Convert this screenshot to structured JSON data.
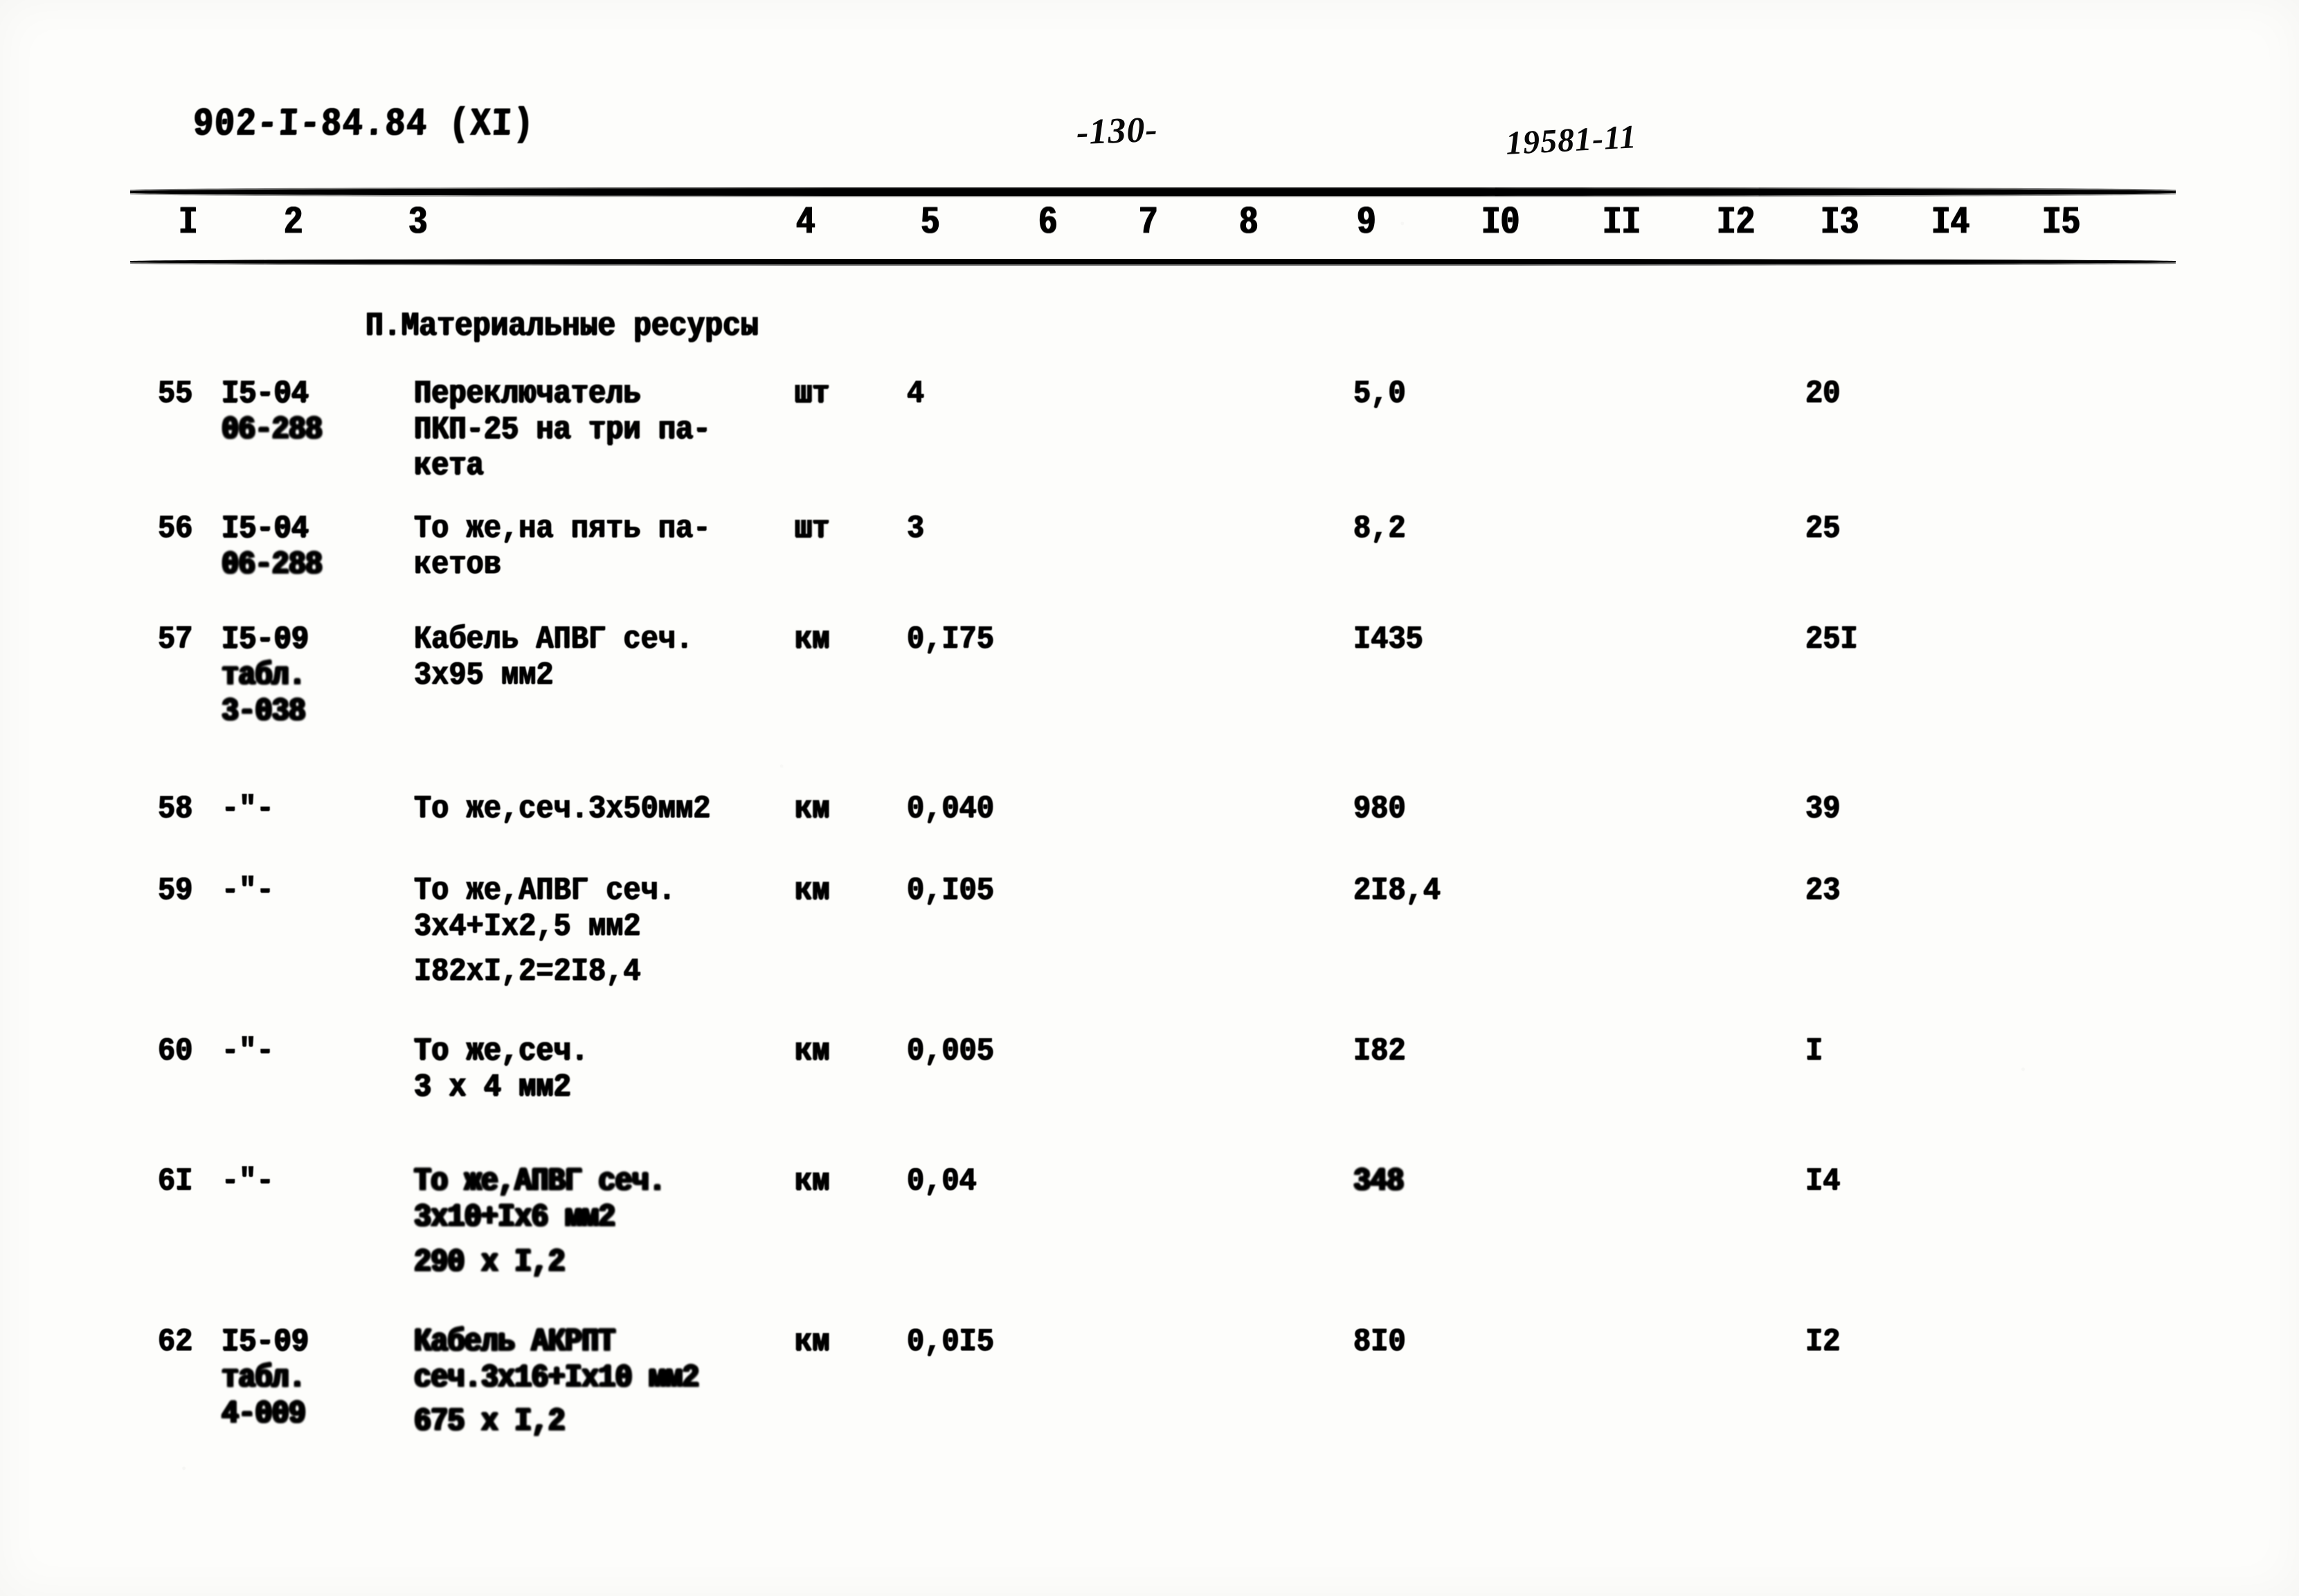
{
  "document": {
    "header_left_code": "902-I-84.84 (XI)",
    "page_number": "-130-",
    "header_right_code": "19581-11",
    "section_title": "П.Материальные ресурсы"
  },
  "table": {
    "column_numbers": [
      "I",
      "2",
      "3",
      "4",
      "5",
      "6",
      "7",
      "8",
      "9",
      "I0",
      "II",
      "I2",
      "I3",
      "I4",
      "I5"
    ],
    "rows": [
      {
        "no": "55",
        "code_lines": [
          "I5-04",
          "06-288"
        ],
        "description_lines": [
          "Переключатель",
          "ПКП-25 на три па-",
          "кета"
        ],
        "unit": "шт",
        "qty": "4",
        "col9": "5,0",
        "col13": "20"
      },
      {
        "no": "56",
        "code_lines": [
          "I5-04",
          "06-288"
        ],
        "description_lines": [
          "То же,на пять па-",
          "кетов"
        ],
        "unit": "шт",
        "qty": "3",
        "col9": "8,2",
        "col13": "25"
      },
      {
        "no": "57",
        "code_lines": [
          "I5-09",
          "табл.",
          "3-038"
        ],
        "description_lines": [
          "Кабель АПВГ сеч.",
          "3х95 мм2"
        ],
        "unit": "км",
        "qty": "0,I75",
        "col9": "I435",
        "col13": "25I"
      },
      {
        "no": "58",
        "code_lines": [
          "-\"-"
        ],
        "description_lines": [
          "То же,сеч.3х50мм2"
        ],
        "unit": "км",
        "qty": "0,040",
        "col9": "980",
        "col13": "39"
      },
      {
        "no": "59",
        "code_lines": [
          "-\"-"
        ],
        "description_lines": [
          "То же,АПВГ сеч.",
          "3х4+Iх2,5 мм2"
        ],
        "calc_line": "I82хI,2=2I8,4",
        "unit": "км",
        "qty": "0,I05",
        "col9": "2I8,4",
        "col13": "23"
      },
      {
        "no": "60",
        "code_lines": [
          "-\"-"
        ],
        "description_lines": [
          "То же,сеч.",
          "3 х 4 мм2"
        ],
        "unit": "км",
        "qty": "0,005",
        "col9": "I82",
        "col13": "I"
      },
      {
        "no": "6I",
        "code_lines": [
          "-\"-"
        ],
        "description_lines": [
          "То же,АПВГ сеч.",
          "3х10+Iх6 мм2"
        ],
        "calc_line": "290 х I,2",
        "unit": "км",
        "qty": "0,04",
        "col9": "348",
        "col13": "I4"
      },
      {
        "no": "62",
        "code_lines": [
          "I5-09",
          "табл.",
          "4-009"
        ],
        "description_lines": [
          "Кабель АКРПТ",
          "сеч.3х16+Iх10 мм2"
        ],
        "calc_line": "675 х I,2",
        "unit": "км",
        "qty": "0,0I5",
        "col9": "8I0",
        "col13": "I2"
      }
    ]
  },
  "colors": {
    "ink": "#0d0d0d",
    "paper": "#fdfdfb"
  }
}
